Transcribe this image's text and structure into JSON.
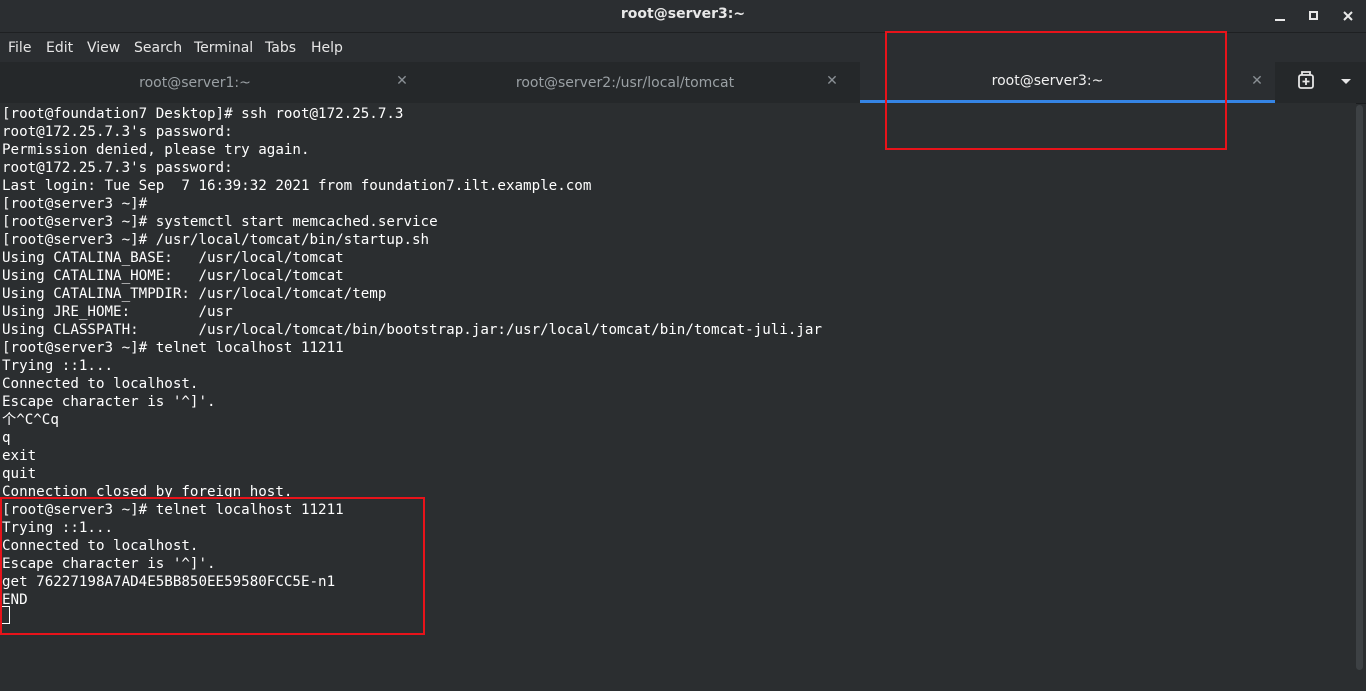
{
  "window": {
    "title": "root@server3:~",
    "minimize_icon": "minimize-icon",
    "maximize_icon": "maximize-icon",
    "close_icon": "close-icon"
  },
  "menubar": {
    "items": [
      {
        "label": "File"
      },
      {
        "label": "Edit"
      },
      {
        "label": "View"
      },
      {
        "label": "Search"
      },
      {
        "label": "Terminal"
      },
      {
        "label": "Tabs"
      },
      {
        "label": "Help"
      }
    ]
  },
  "tabs": [
    {
      "label": "root@server1:~",
      "active": false
    },
    {
      "label": "root@server2:/usr/local/tomcat",
      "active": false
    },
    {
      "label": "root@server3:~",
      "active": true
    }
  ],
  "terminal": {
    "lines": [
      "[root@foundation7 Desktop]# ssh root@172.25.7.3",
      "root@172.25.7.3's password:",
      "Permission denied, please try again.",
      "root@172.25.7.3's password:",
      "Last login: Tue Sep  7 16:39:32 2021 from foundation7.ilt.example.com",
      "[root@server3 ~]#",
      "[root@server3 ~]# systemctl start memcached.service",
      "[root@server3 ~]# /usr/local/tomcat/bin/startup.sh",
      "Using CATALINA_BASE:   /usr/local/tomcat",
      "Using CATALINA_HOME:   /usr/local/tomcat",
      "Using CATALINA_TMPDIR: /usr/local/tomcat/temp",
      "Using JRE_HOME:        /usr",
      "Using CLASSPATH:       /usr/local/tomcat/bin/bootstrap.jar:/usr/local/tomcat/bin/tomcat-juli.jar",
      "[root@server3 ~]# telnet localhost 11211",
      "Trying ::1...",
      "Connected to localhost.",
      "Escape character is '^]'.",
      "个^C^Cq",
      "q",
      "exit",
      "quit",
      "Connection closed by foreign host.",
      "[root@server3 ~]# telnet localhost 11211",
      "Trying ::1...",
      "Connected to localhost.",
      "Escape character is '^]'.",
      "get 76227198A7AD4E5BB850EE59580FCC5E-n1",
      "END"
    ]
  },
  "colors": {
    "accent": "#3584e4",
    "annotation": "#e8131a",
    "background": "#2b2e30"
  }
}
